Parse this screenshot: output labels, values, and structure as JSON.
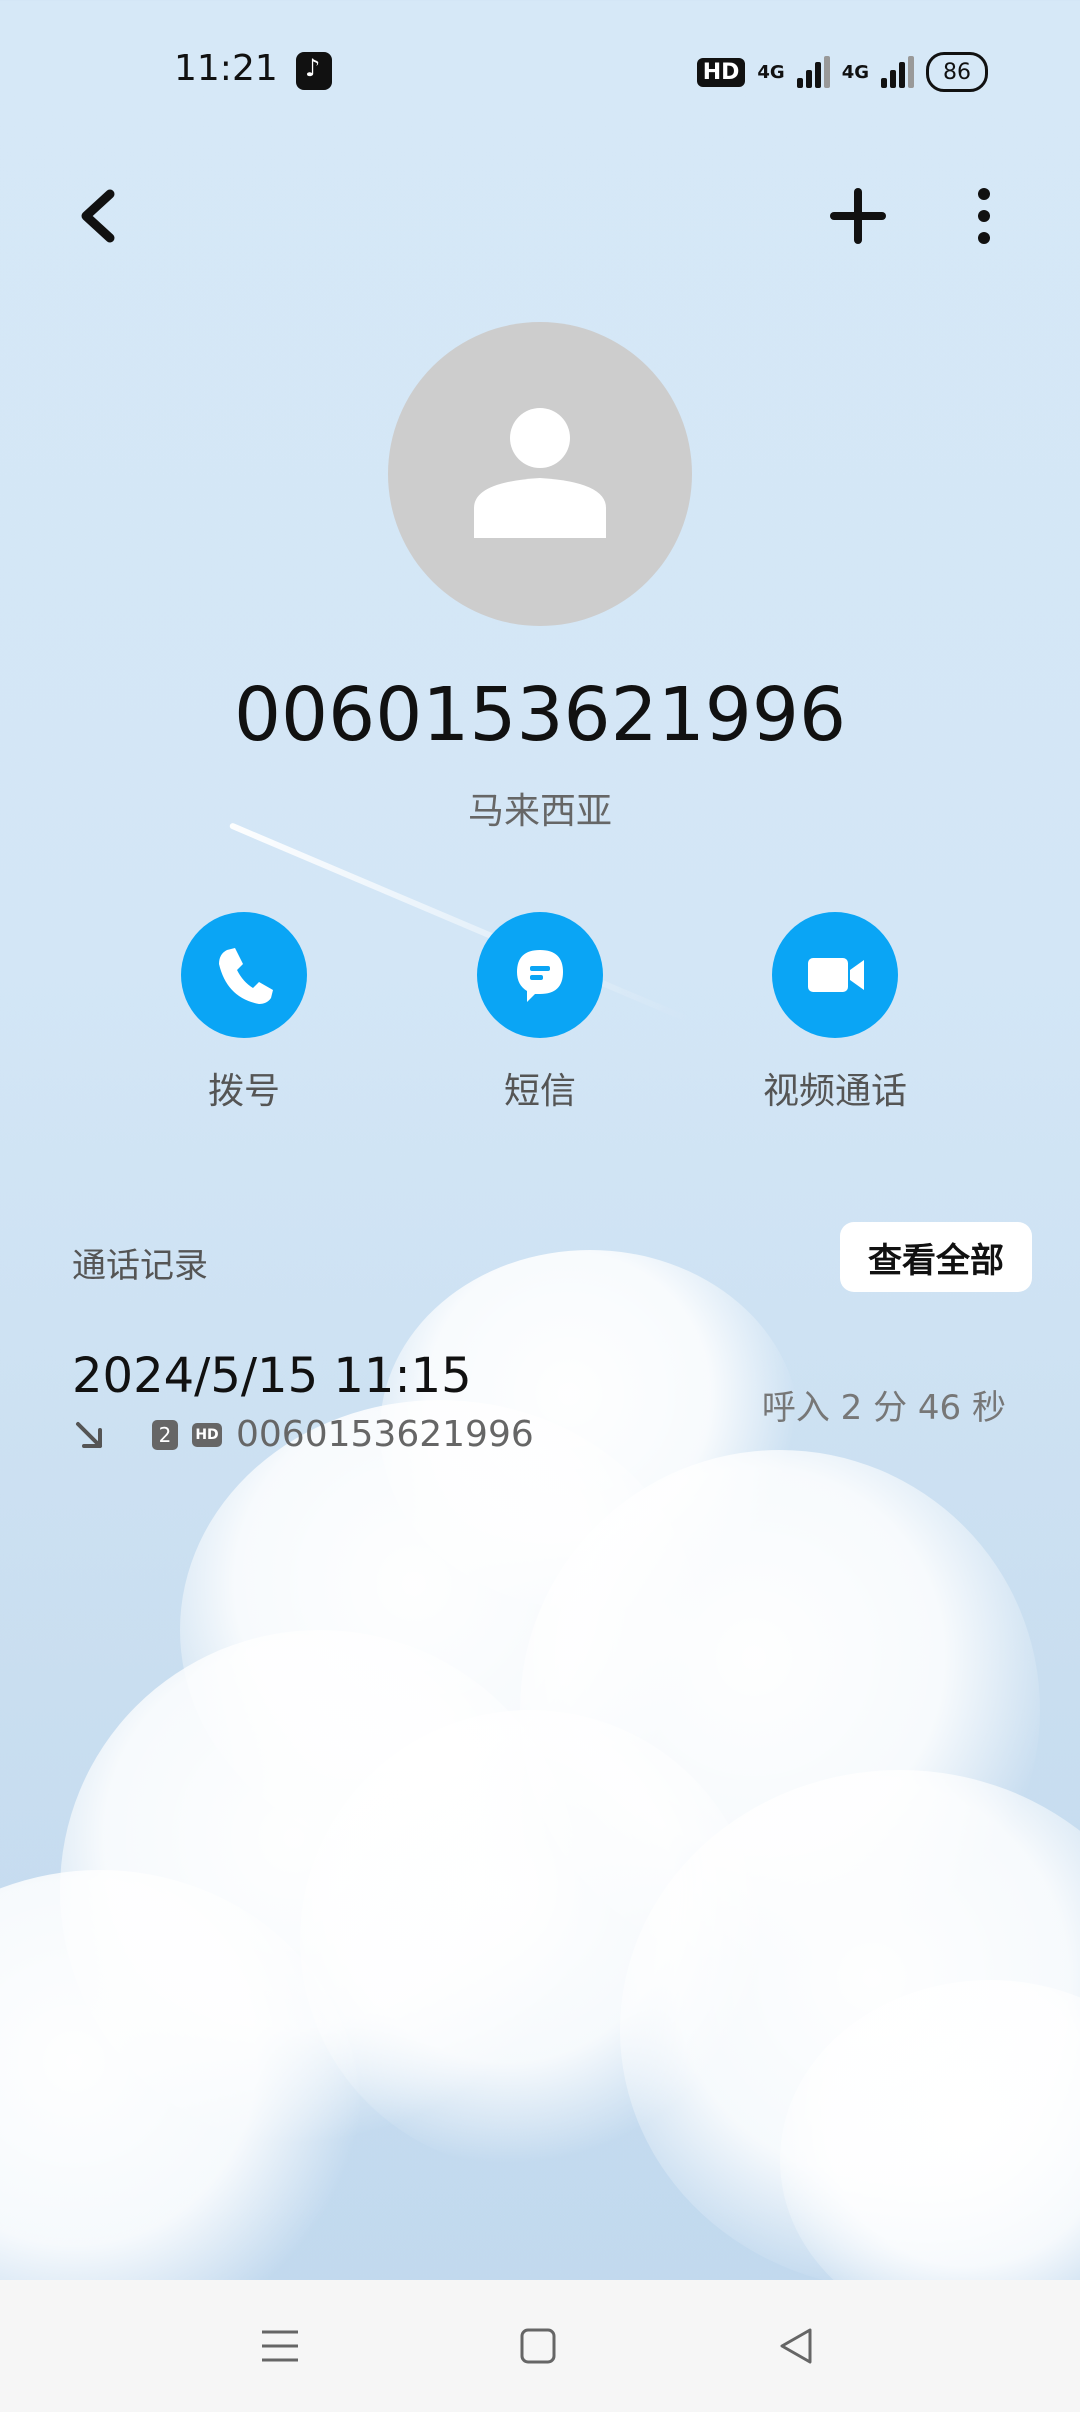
{
  "status_bar": {
    "time": "11:21",
    "network_badge": "HD",
    "sim1_network": "4G",
    "sim2_network": "4G",
    "battery": "86"
  },
  "toolbar": {
    "back_icon": "chevron-left-icon",
    "add_icon": "plus-icon",
    "more_icon": "more-vertical-icon"
  },
  "contact": {
    "number": "0060153621996",
    "location": "马来西亚"
  },
  "actions": [
    {
      "label": "拨号",
      "icon": "phone-icon"
    },
    {
      "label": "短信",
      "icon": "message-icon"
    },
    {
      "label": "视频通话",
      "icon": "video-camera-icon"
    }
  ],
  "call_log": {
    "title": "通话记录",
    "view_all": "查看全部",
    "entries": [
      {
        "datetime": "2024/5/15 11:15",
        "sim": "2",
        "hd": "HD",
        "number": "0060153621996",
        "summary": "呼入  2 分 46 秒"
      }
    ]
  },
  "colors": {
    "accent": "#0aa5f5",
    "background": "#d6e8f7"
  }
}
